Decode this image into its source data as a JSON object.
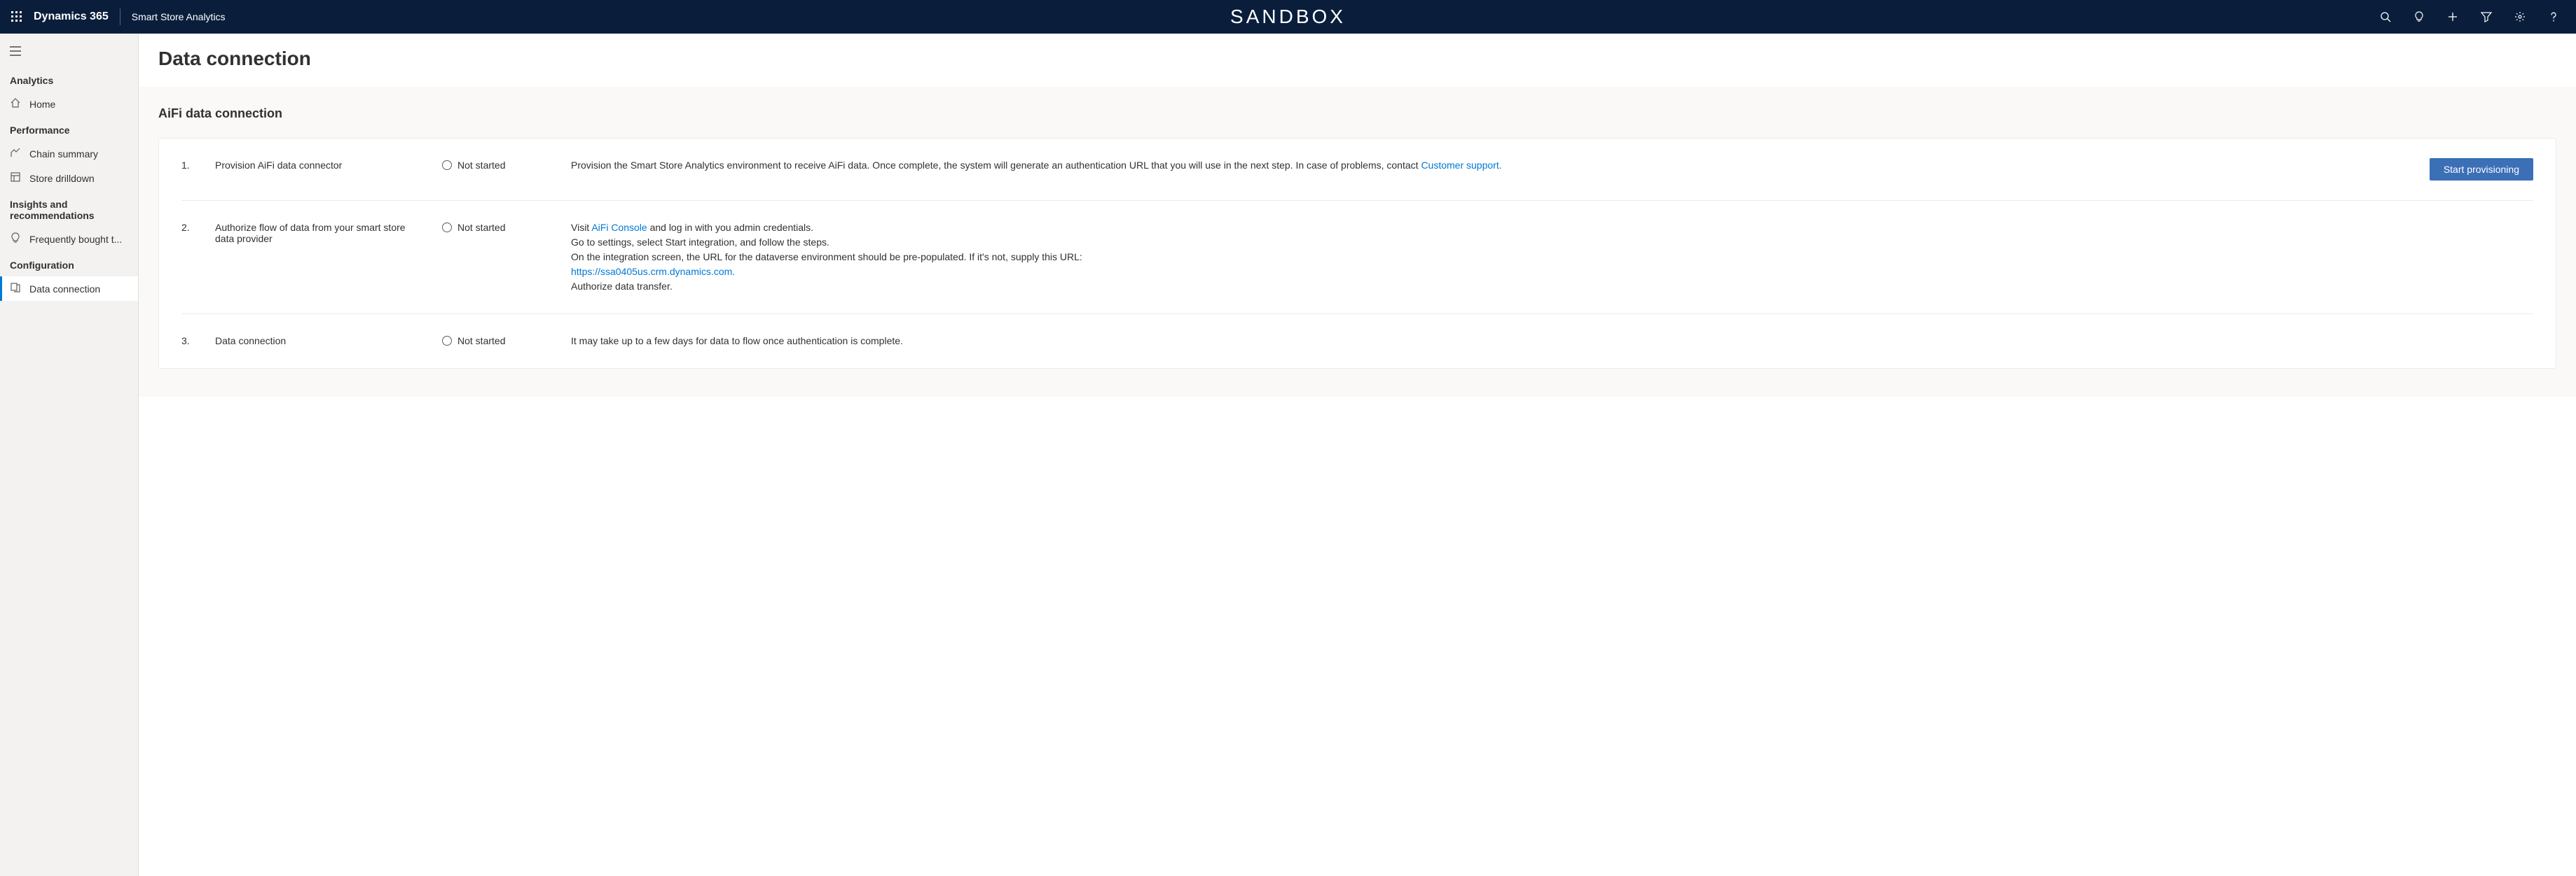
{
  "header": {
    "app_title": "Dynamics 365",
    "app_subtitle": "Smart Store Analytics",
    "center_text": "SANDBOX"
  },
  "sidebar": {
    "groups": [
      {
        "title": "Analytics",
        "items": [
          {
            "icon": "home",
            "label": "Home"
          }
        ]
      },
      {
        "title": "Performance",
        "items": [
          {
            "icon": "chart",
            "label": "Chain summary"
          },
          {
            "icon": "store",
            "label": "Store drilldown"
          }
        ]
      },
      {
        "title": "Insights and recommendations",
        "items": [
          {
            "icon": "bulb",
            "label": "Frequently bought t..."
          }
        ]
      },
      {
        "title": "Configuration",
        "items": [
          {
            "icon": "data",
            "label": "Data connection",
            "active": true
          }
        ]
      }
    ]
  },
  "page": {
    "title": "Data connection",
    "section_title": "AiFi data connection"
  },
  "steps": [
    {
      "num": "1.",
      "title": "Provision AiFi data connector",
      "status": "Not started",
      "desc_parts": [
        {
          "text": "Provision the Smart Store Analytics environment to receive AiFi data. Once complete, the system will generate an authentication URL that you will use in the next step. In case of problems, contact "
        },
        {
          "text": "Customer support.",
          "link": true
        }
      ],
      "action_label": "Start provisioning"
    },
    {
      "num": "2.",
      "title": "Authorize flow of data from your smart store data provider",
      "status": "Not started",
      "desc_lines": [
        [
          {
            "text": "Visit "
          },
          {
            "text": "AiFi Console",
            "link": true
          },
          {
            "text": " and log in with you admin credentials."
          }
        ],
        [
          {
            "text": "Go to settings, select Start integration, and follow the steps."
          }
        ],
        [
          {
            "text": "On the integration screen, the URL for the dataverse environment should be pre-populated. If it's not, supply this URL: "
          }
        ],
        [
          {
            "text": "https://ssa0405us.crm.dynamics.com.",
            "link": true
          }
        ],
        [
          {
            "text": "Authorize data transfer."
          }
        ]
      ]
    },
    {
      "num": "3.",
      "title": "Data connection",
      "status": "Not started",
      "desc_parts": [
        {
          "text": "It may take up to a few days for data to flow once authentication is complete."
        }
      ]
    }
  ]
}
